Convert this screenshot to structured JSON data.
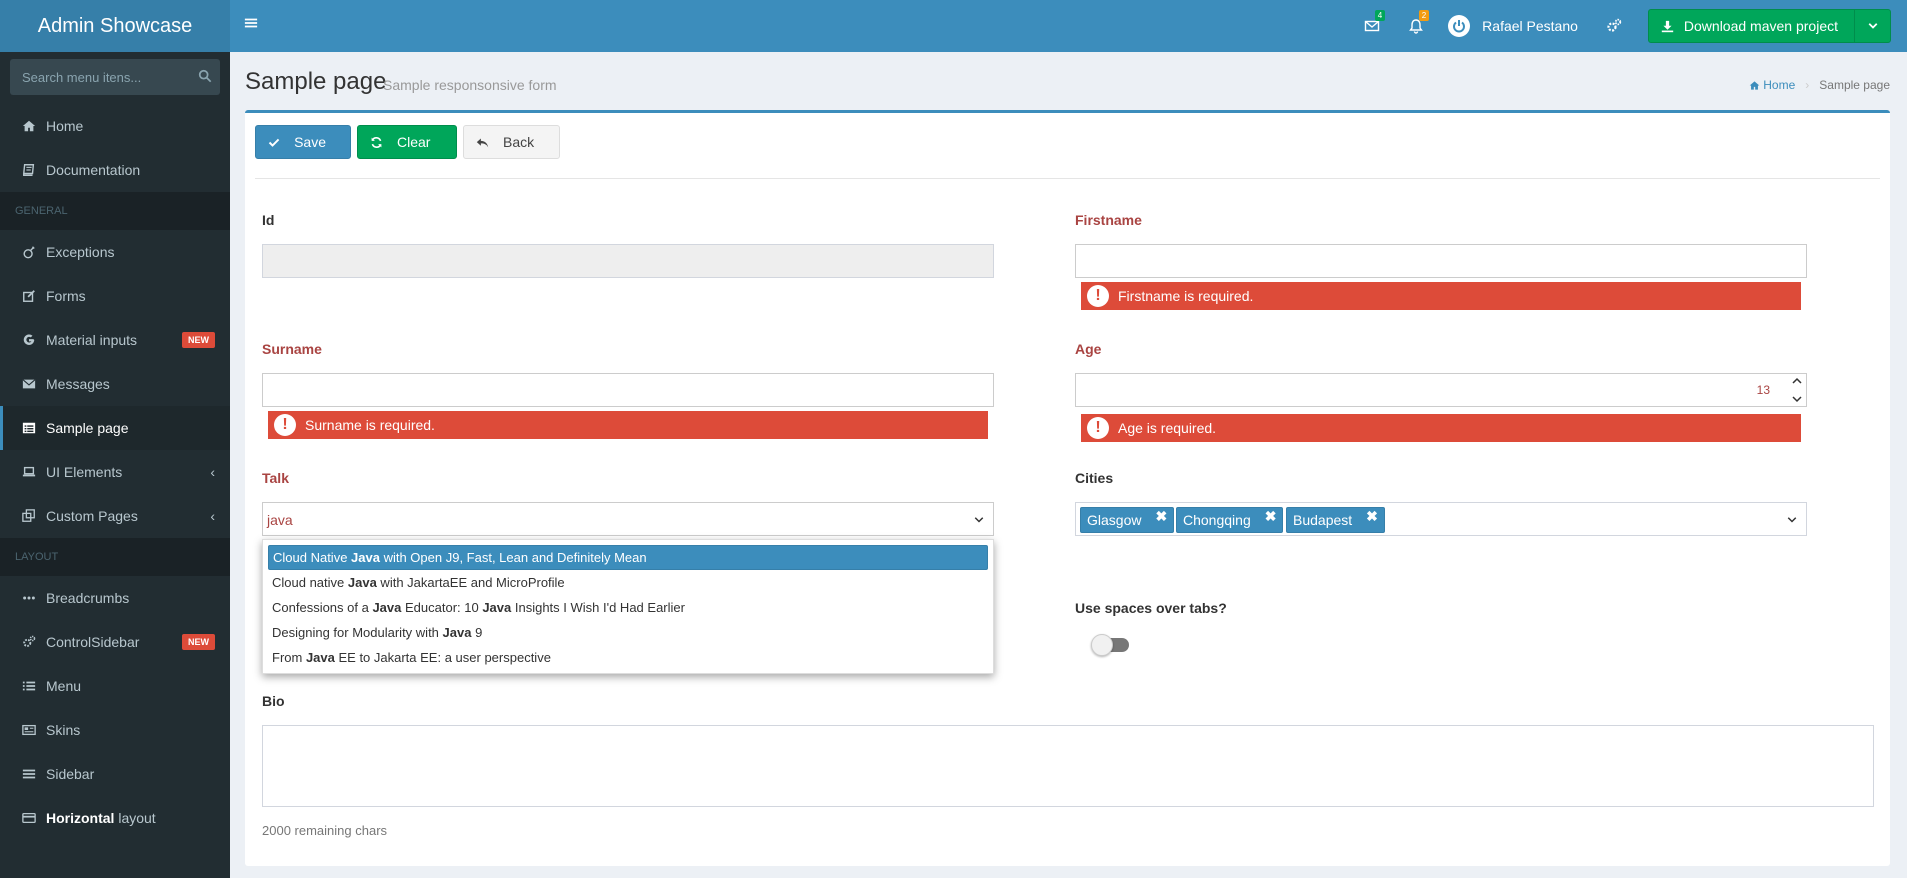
{
  "brand": "Admin Showcase",
  "sidebar": {
    "search_placeholder": "Search menu itens...",
    "items": [
      {
        "label": "Home"
      },
      {
        "label": "Documentation"
      },
      {
        "header": "GENERAL"
      },
      {
        "label": "Exceptions"
      },
      {
        "label": "Forms"
      },
      {
        "label": "Material inputs",
        "badge": "NEW"
      },
      {
        "label": "Messages"
      },
      {
        "label": "Sample page"
      },
      {
        "label": "UI Elements"
      },
      {
        "label": "Custom Pages"
      },
      {
        "header": "LAYOUT"
      },
      {
        "label": "Breadcrumbs"
      },
      {
        "label": "ControlSidebar",
        "badge": "NEW"
      },
      {
        "label": "Menu"
      },
      {
        "label": "Skins"
      },
      {
        "label": "Sidebar"
      },
      {
        "label_bold": "Horizontal",
        "label_rest": " layout"
      }
    ]
  },
  "navbar": {
    "messages_count": "4",
    "notifications_count": "2",
    "user_name": "Rafael Pestano",
    "download_label": "Download maven project"
  },
  "page": {
    "title": "Sample page",
    "subtitle": "Sample responsonsive form",
    "breadcrumb_home": "Home",
    "breadcrumb_current": "Sample page"
  },
  "toolbar": {
    "save": "Save",
    "clear": "Clear",
    "back": "Back"
  },
  "form": {
    "id_label": "Id",
    "firstname_label": "Firstname",
    "firstname_error": "Firstname is required.",
    "surname_label": "Surname",
    "surname_error": "Surname is required.",
    "age_label": "Age",
    "age_value": "13",
    "age_error": "Age is required.",
    "talk_label": "Talk",
    "talk_value": "java",
    "talk_suggestions": [
      {
        "pre": "Cloud Native ",
        "bold": "Java",
        "post": " with Open J9, Fast, Lean and Definitely Mean"
      },
      {
        "pre": "Cloud native ",
        "bold": "Java",
        "post": " with JakartaEE and MicroProfile"
      },
      {
        "pre": "Confessions of a ",
        "bold": "Java",
        "post": " Educator: 10 ",
        "bold2": "Java",
        "post2": " Insights I Wish I'd Had Earlier"
      },
      {
        "pre": "Designing for Modularity with ",
        "bold": "Java",
        "post": " 9"
      },
      {
        "pre": "From ",
        "bold": "Java",
        "post": " EE to Jakarta EE: a user perspective"
      }
    ],
    "cities_label": "Cities",
    "cities": [
      "Glasgow",
      "Chongqing",
      "Budapest"
    ],
    "spaces_label": "Use spaces over tabs?",
    "bio_label": "Bio",
    "bio_remaining": "2000 remaining chars"
  },
  "colors": {
    "primary": "#3c8dbc",
    "success": "#00a65a",
    "danger": "#dd4b39",
    "sidebar_bg": "#222d32"
  }
}
